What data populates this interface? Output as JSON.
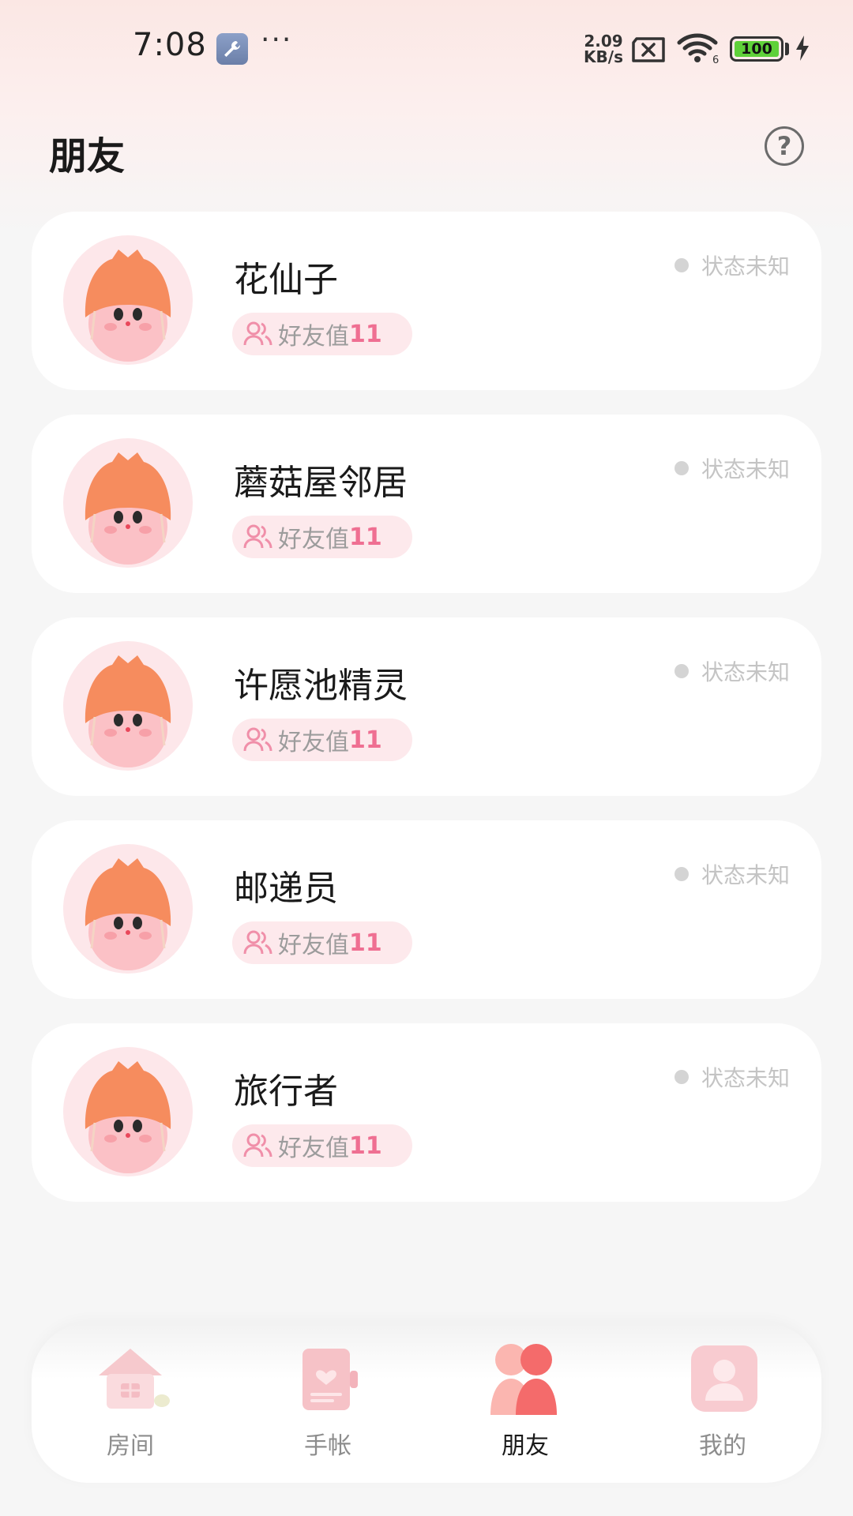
{
  "status_bar": {
    "time": "7:08",
    "net_speed_value": "2.09",
    "net_speed_unit": "KB/s",
    "wifi_sub": "6",
    "battery": "100"
  },
  "header": {
    "title": "朋友",
    "help_glyph": "?"
  },
  "friends": [
    {
      "name": "花仙子",
      "badge_label": "好友值",
      "badge_value": "11",
      "status": "状态未知"
    },
    {
      "name": "蘑菇屋邻居",
      "badge_label": "好友值",
      "badge_value": "11",
      "status": "状态未知"
    },
    {
      "name": "许愿池精灵",
      "badge_label": "好友值",
      "badge_value": "11",
      "status": "状态未知"
    },
    {
      "name": "邮递员",
      "badge_label": "好友值",
      "badge_value": "11",
      "status": "状态未知"
    },
    {
      "name": "旅行者",
      "badge_label": "好友值",
      "badge_value": "11",
      "status": "状态未知"
    }
  ],
  "tabbar": {
    "tabs": [
      {
        "label": "房间",
        "icon": "house-icon",
        "active": false
      },
      {
        "label": "手帐",
        "icon": "notebook-icon",
        "active": false
      },
      {
        "label": "朋友",
        "icon": "friends-icon",
        "active": true
      },
      {
        "label": "我的",
        "icon": "profile-icon",
        "active": false
      }
    ]
  },
  "colors": {
    "accent_pink": "#ef6f92",
    "badge_bg": "#fde9ec",
    "status_dot": "#d4d4d4",
    "avatar_bg": "#fde7ea"
  }
}
